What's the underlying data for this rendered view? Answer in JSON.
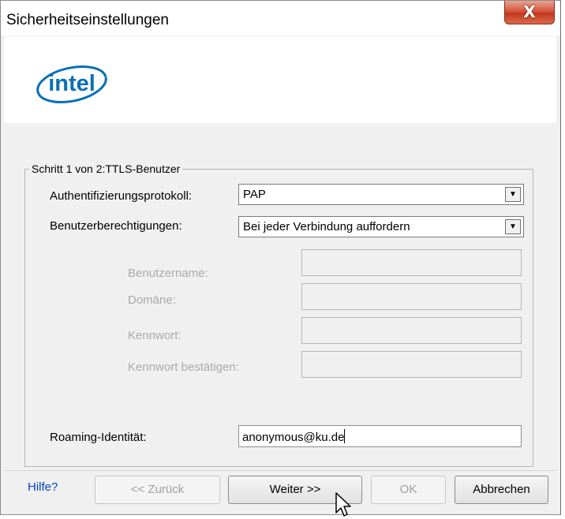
{
  "window": {
    "title": "Sicherheitseinstellungen",
    "close_label": "X"
  },
  "logo": {
    "text": "intel"
  },
  "group": {
    "legend": "Schritt 1 von 2:TTLS-Benutzer",
    "auth_protocol_label": "Authentifizierungsprotokoll:",
    "auth_protocol_value": "PAP",
    "user_credentials_label": "Benutzerberechtigungen:",
    "user_credentials_value": "Bei jeder Verbindung auffordern",
    "username_label": "Benutzername:",
    "domain_label": "Domäne:",
    "password_label": "Kennwort:",
    "confirm_password_label": "Kennwort bestätigen:",
    "roaming_identity_label": "Roaming-Identität:",
    "roaming_identity_value": "anonymous@ku.de"
  },
  "footer": {
    "help_link": "Hilfe?",
    "back_button": "<< Zurück",
    "next_button": "Weiter >>",
    "ok_button": "OK",
    "cancel_button": "Abbrechen"
  },
  "icons": {
    "close": "close-icon",
    "dropdown": "chevron-down-icon",
    "cursor": "mouse-pointer-icon"
  }
}
